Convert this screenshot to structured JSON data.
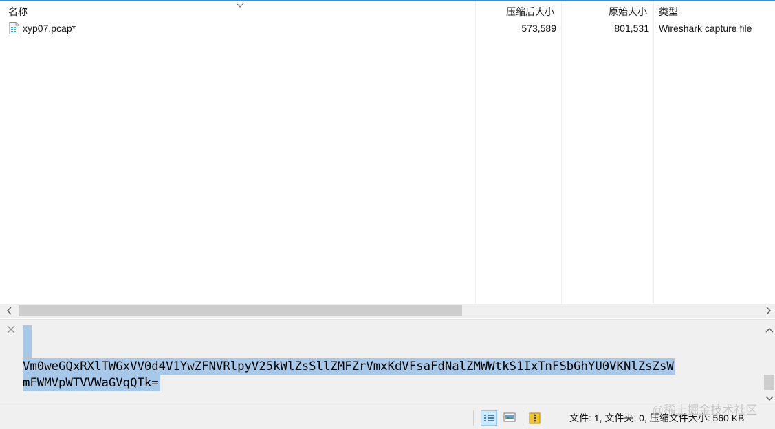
{
  "columns": {
    "name": "名称",
    "compressed_size": "压缩后大小",
    "original_size": "原始大小",
    "type": "类型"
  },
  "files": [
    {
      "name": "xyp07.pcap*",
      "compressed_size": "573,589",
      "original_size": "801,531",
      "type": "Wireshark capture file",
      "icon": "pcap-file-icon"
    }
  ],
  "comment": {
    "line1": "Vm0weGQxRXlTWGxVV0d4V1YwZFNVRlpyV25kWlZsSllZMFZrVmxKdVFsaFdNalZMWWtkS1IxTnFSbGhYU0VKNlZsZsW",
    "line2": "mFWMVpWTVVWaGVqQTk=",
    "selection_color": "#a7c8e8"
  },
  "status": {
    "text": "文件: 1, 文件夹: 0, 压缩文件大小: 560 KB"
  },
  "watermark": "@稀土掘金技术社区",
  "colors": {
    "accent": "#3b8fd8",
    "panel_bg": "#f0f0f0",
    "scroll_thumb": "#cdcdcd"
  }
}
